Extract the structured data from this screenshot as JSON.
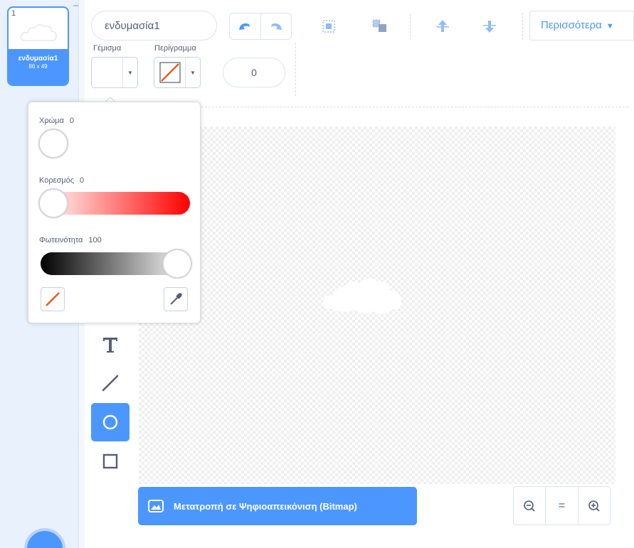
{
  "costume": {
    "number": "1",
    "name": "ενδυμασία1",
    "size": "86 x 49"
  },
  "toolbar": {
    "costume_name_value": "ενδυμασία1",
    "more_label": "Περισσότερα",
    "fill_label": "Γέμισμα",
    "outline_label": "Περίγραμμα",
    "outline_width_value": "0"
  },
  "colors": {
    "accent": "#4c97ff",
    "text": "#575e75",
    "outline_none": "#e55b1a"
  },
  "color_popup": {
    "hue_label": "Χρώμα",
    "hue_value": "0",
    "saturation_label": "Κορεσμός",
    "saturation_value": "0",
    "brightness_label": "Φωτεινότητα",
    "brightness_value": "100"
  },
  "tools": [
    "text-tool",
    "line-tool",
    "circle-tool",
    "rectangle-tool"
  ],
  "bitmap_button_label": "Μετατροπή σε Ψηφιοαπεικόνιση (Bitmap)",
  "zoom": {
    "zoom_out": "zoom-out-icon",
    "reset": "=",
    "zoom_in": "zoom-in-icon"
  }
}
